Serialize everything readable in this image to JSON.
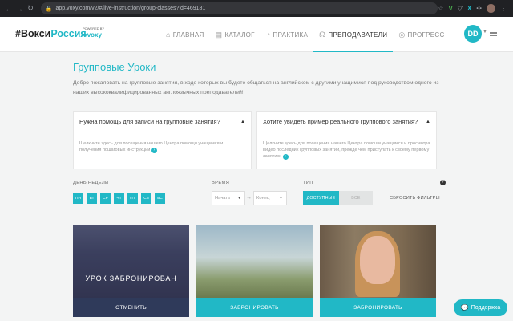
{
  "browser": {
    "url": "app.voxy.com/v2/#/live-instruction/group-classes?id=469181",
    "ext_v": "V",
    "ext_x": "X"
  },
  "nav": {
    "logo_prefix": "#Вокси",
    "logo_accent": "Россия",
    "powered_by": "POWERED BY",
    "powered_brand": "voxy",
    "items": [
      {
        "icon": "⌂",
        "label": "ГЛАВНАЯ",
        "active": false
      },
      {
        "icon": "▤",
        "label": "КАТАЛОГ",
        "active": false
      },
      {
        "icon": "◔",
        "label": "ПРАКТИКА",
        "active": false
      },
      {
        "icon": "☊",
        "label": "ПРЕПОДАВАТЕЛИ",
        "active": true
      },
      {
        "icon": "◎",
        "label": "ПРОГРЕСС",
        "active": false
      }
    ],
    "avatar_initials": "DD"
  },
  "page": {
    "title": "Групповые Уроки",
    "intro": "Добро пожаловать на групповые занятия, в ходе которых вы будете общаться на английском с другими учащимися под руководством одного из наших высококвалифицированных англоязычных преподавателей!"
  },
  "help_boxes": [
    {
      "title": "Нужна помощь для записи на групповые занятия?",
      "body": "Щелкните здесь для посещения нашего Центра помощи учащимся и получения пошаговых инструкций"
    },
    {
      "title": "Хотите увидеть пример реального группового занятия?",
      "body": "Щелкните здесь для посещения нашего Центра помощи учащимся и просмотра видео последних групповых занятий, прежде чем приступать к своему первому занятию!"
    }
  ],
  "filters": {
    "day_label": "ДЕНЬ НЕДЕЛИ",
    "days": [
      "ПН",
      "ВТ",
      "СР",
      "ЧТ",
      "ПТ",
      "СБ",
      "ВС"
    ],
    "time_label": "ВРЕМЯ",
    "time_start_placeholder": "Начать",
    "time_end_placeholder": "Конец",
    "type_label": "ТИП",
    "type_available": "ДОСТУПНЫЕ",
    "type_all": "ВСЕ",
    "reset": "СБРОСИТЬ ФИЛЬТРЫ",
    "help": "?"
  },
  "cards": [
    {
      "overlay_text": "УРОК ЗАБРОНИРОВАН",
      "button": "ОТМЕНИТЬ"
    },
    {
      "overlay_text": "",
      "button": "ЗАБРОНИРОВАТЬ"
    },
    {
      "overlay_text": "",
      "button": "ЗАБРОНИРОВАТЬ"
    }
  ],
  "support": {
    "label": "Поддержка"
  },
  "colors": {
    "accent": "#21b8c6",
    "cancel": "#2f3a5a"
  }
}
